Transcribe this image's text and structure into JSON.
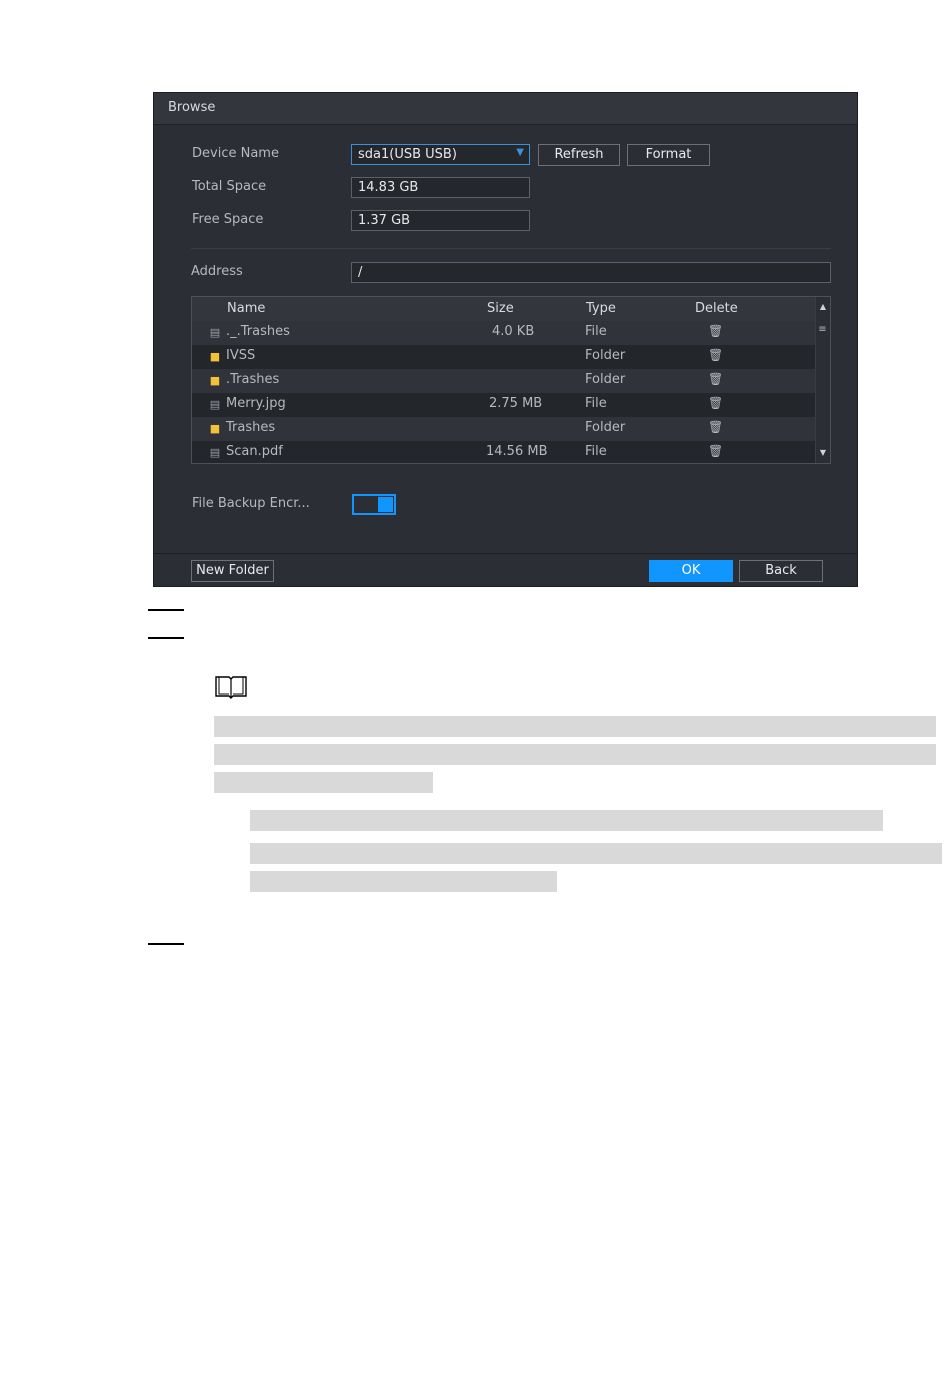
{
  "dialog": {
    "title": "Browse",
    "device_name_label": "Device Name",
    "device_name_value": "sda1(USB USB)",
    "refresh_label": "Refresh",
    "format_label": "Format",
    "total_space_label": "Total Space",
    "total_space_value": "14.83 GB",
    "free_space_label": "Free Space",
    "free_space_value": "1.37 GB",
    "address_label": "Address",
    "address_value": "/",
    "columns": {
      "name": "Name",
      "size": "Size",
      "type": "Type",
      "delete": "Delete"
    },
    "files": [
      {
        "name": "._.Trashes",
        "size": "4.0 KB",
        "type": "File",
        "icon": "file-icon"
      },
      {
        "name": "IVSS",
        "size": "",
        "type": "Folder",
        "icon": "folder-icon"
      },
      {
        "name": ".Trashes",
        "size": "",
        "type": "Folder",
        "icon": "folder-icon"
      },
      {
        "name": "Merry.jpg",
        "size": "2.75 MB",
        "type": "File",
        "icon": "file-icon"
      },
      {
        "name": "Trashes",
        "size": "",
        "type": "Folder",
        "icon": "folder-icon"
      },
      {
        "name": "Scan.pdf",
        "size": "14.56 MB",
        "type": "File",
        "icon": "file-icon"
      }
    ],
    "encrypt_label": "File Backup Encr...",
    "encrypt_enabled": true,
    "new_folder_label": "New Folder",
    "ok_label": "OK",
    "back_label": "Back"
  },
  "colors": {
    "accent": "#1195ff",
    "dialog_bg": "#2b2e34",
    "folder": "#f2c23a"
  }
}
